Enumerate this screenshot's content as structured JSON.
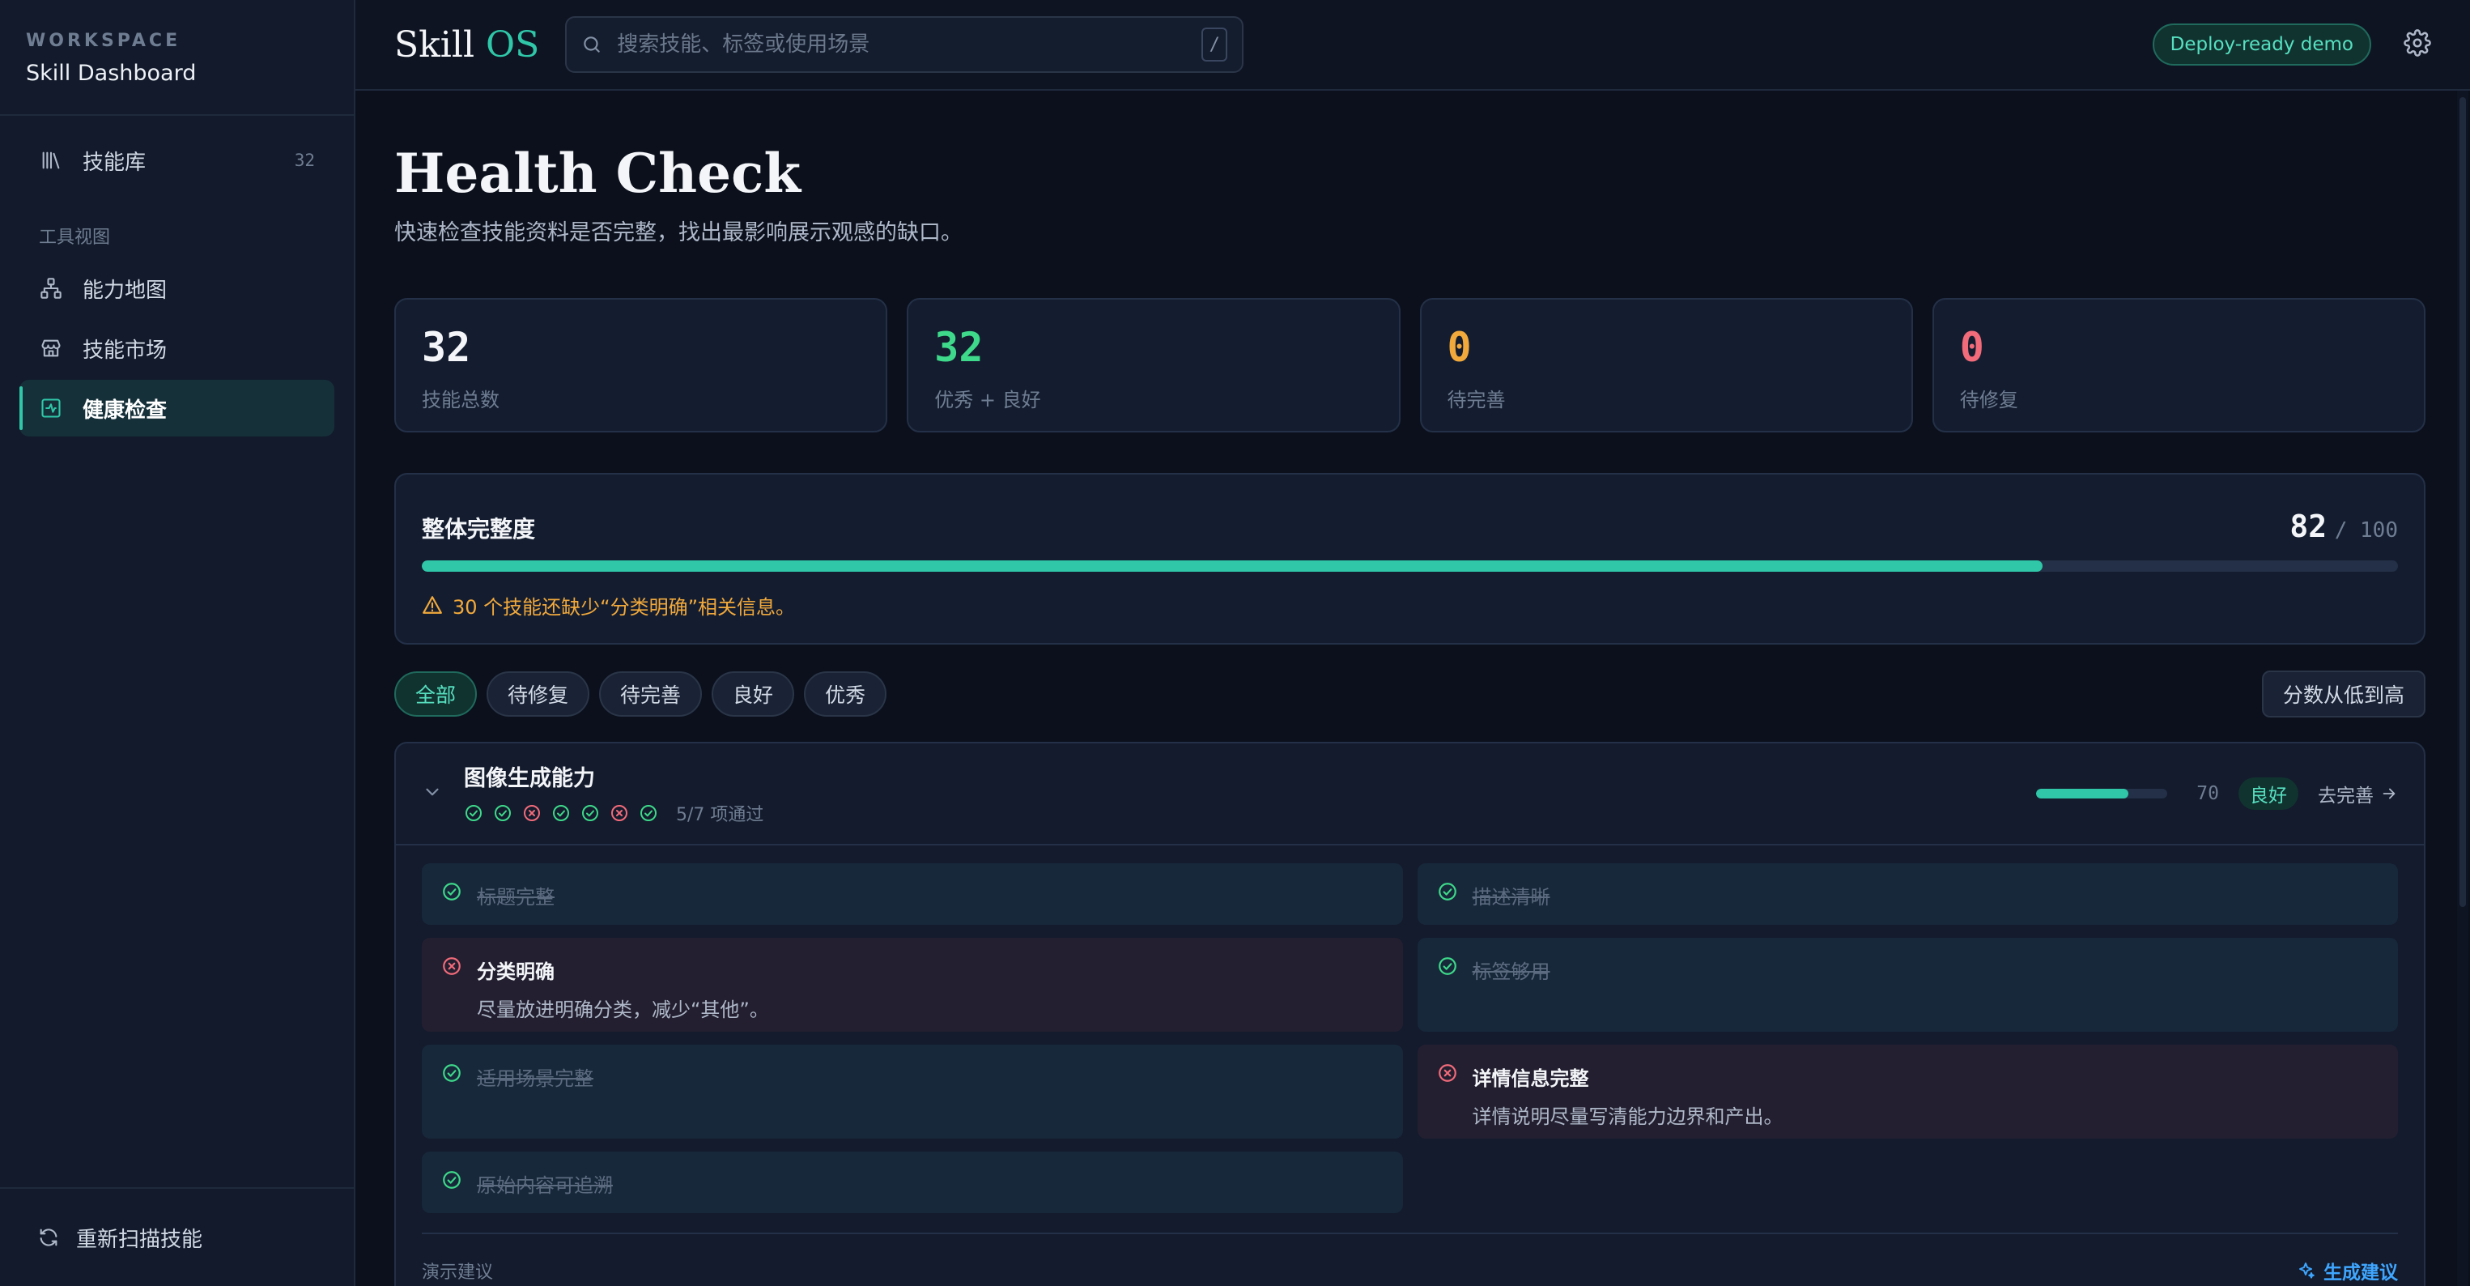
{
  "workspace": {
    "label": "WORKSPACE",
    "name": "Skill Dashboard"
  },
  "sidebar": {
    "library": {
      "label": "技能库",
      "count": "32"
    },
    "group_label": "工具视图",
    "items": [
      {
        "label": "能力地图",
        "icon": "network-icon"
      },
      {
        "label": "技能市场",
        "icon": "store-icon"
      },
      {
        "label": "健康检查",
        "icon": "health-icon",
        "active": true
      }
    ],
    "rescan_label": "重新扫描技能"
  },
  "topbar": {
    "brand_main": "Skill",
    "brand_accent": "OS",
    "search_placeholder": "搜索技能、标签或使用场景",
    "search_shortcut": "/",
    "demo_badge": "Deploy-ready demo"
  },
  "page": {
    "title": "Health Check",
    "subtitle": "快速检查技能资料是否完整，找出最影响展示观感的缺口。"
  },
  "stats": [
    {
      "value": "32",
      "label": "技能总数",
      "color": "#f3f5f8"
    },
    {
      "value": "32",
      "label": "优秀 + 良好",
      "color": "#3ed98a"
    },
    {
      "value": "0",
      "label": "待完善",
      "color": "#f2a93b"
    },
    {
      "value": "0",
      "label": "待修复",
      "color": "#f26b7a"
    }
  ],
  "completeness": {
    "title": "整体完整度",
    "score": "82",
    "max": "/ 100",
    "percent": 82,
    "warning": "30 个技能还缺少“分类明确”相关信息。"
  },
  "filters": {
    "chips": [
      "全部",
      "待修复",
      "待完善",
      "良好",
      "优秀"
    ],
    "active": 0,
    "sort_label": "分数从低到高"
  },
  "skill": {
    "name": "图像生成能力",
    "checks": [
      "pass",
      "pass",
      "fail",
      "pass",
      "pass",
      "fail",
      "pass"
    ],
    "passed_text": "5/7 项通过",
    "score": "70",
    "percent": 70,
    "grade": "良好",
    "improve_label": "去完善",
    "items": [
      {
        "label": "标题完整",
        "status": "pass",
        "desc": ""
      },
      {
        "label": "描述清晰",
        "status": "pass",
        "desc": ""
      },
      {
        "label": "分类明确",
        "status": "fail",
        "desc": "尽量放进明确分类，减少“其他”。"
      },
      {
        "label": "标签够用",
        "status": "pass",
        "desc": ""
      },
      {
        "label": "适用场景完整",
        "status": "pass",
        "desc": ""
      },
      {
        "label": "详情信息完整",
        "status": "fail",
        "desc": "详情说明尽量写清能力边界和产出。"
      },
      {
        "label": "原始内容可追溯",
        "status": "pass",
        "desc": ""
      }
    ],
    "suggestion_label": "演示建议",
    "generate_label": "生成建议"
  },
  "colors": {
    "accent": "#2fc7a8",
    "pass": "#3ed98a",
    "fail": "#f26b7a",
    "warn": "#f2a93b",
    "link": "#3fa6ff"
  }
}
